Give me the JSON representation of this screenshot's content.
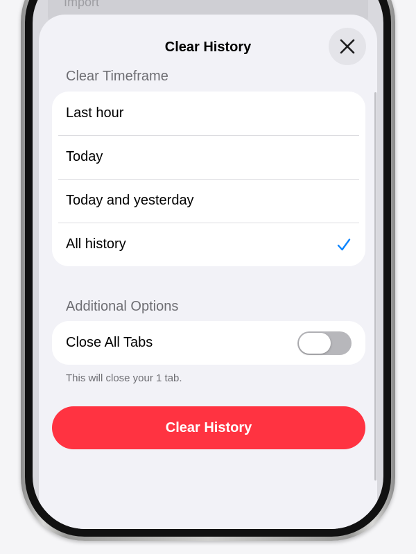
{
  "background_app": {
    "partial_text": "Import"
  },
  "sheet": {
    "title": "Clear History",
    "close_icon": "close-icon"
  },
  "timeframe": {
    "header": "Clear Timeframe",
    "options": [
      {
        "label": "Last hour",
        "selected": false
      },
      {
        "label": "Today",
        "selected": false
      },
      {
        "label": "Today and yesterday",
        "selected": false
      },
      {
        "label": "All history",
        "selected": true
      }
    ],
    "selected_icon": "checkmark-icon",
    "accent_color": "#0a84ff"
  },
  "additional_options": {
    "header": "Additional Options",
    "close_all_tabs": {
      "label": "Close All Tabs",
      "enabled": false
    },
    "footnote": "This will close your 1 tab."
  },
  "primary_action": {
    "label": "Clear History",
    "color": "#ff3341"
  }
}
